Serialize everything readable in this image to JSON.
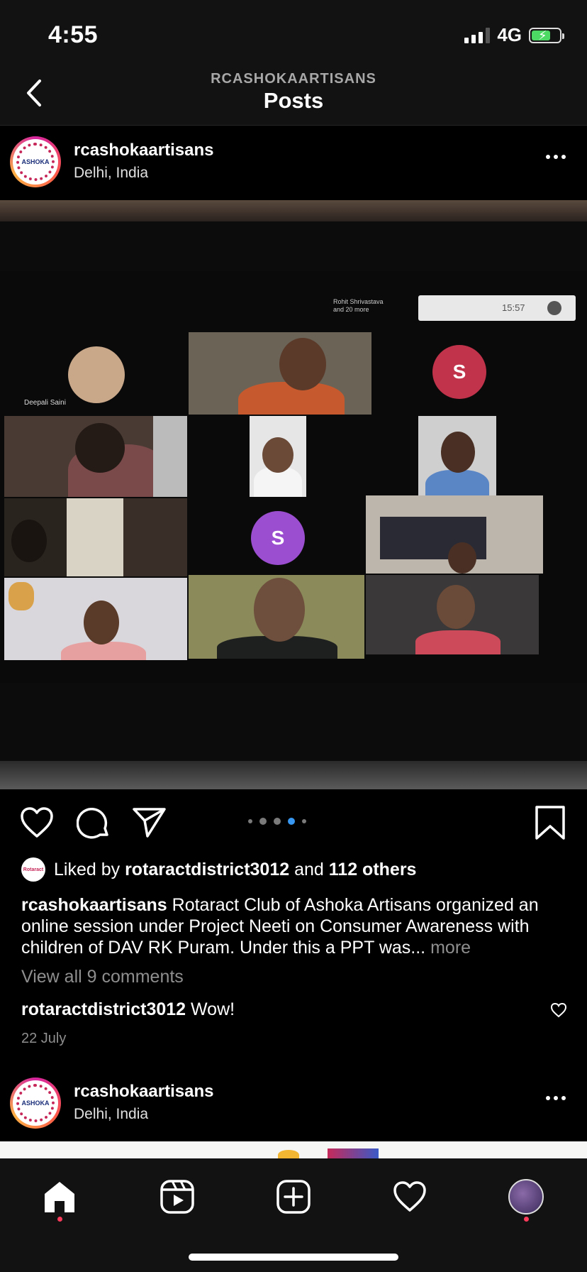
{
  "status_bar": {
    "time": "4:55",
    "network": "4G",
    "battery_percent": 60,
    "signal_bars_on": 3,
    "signal_bars_total": 4
  },
  "header": {
    "subtitle": "RCASHOKAARTISANS",
    "title": "Posts"
  },
  "post": {
    "username": "rcashokaartisans",
    "location": "Delhi, India",
    "carousel": {
      "count": 5,
      "active_index": 3
    },
    "photo_screen": {
      "participant_caption": "Deepali Saini",
      "participants_label_line1": "Rohit Shrivastava",
      "participants_label_line2": "and 20 more",
      "clock": "15:57",
      "initial_1": "S",
      "initial_2": "S"
    },
    "likes": {
      "prefix": "Liked by",
      "user": "rotaractdistrict3012",
      "joiner": "and",
      "others": "112 others",
      "avatar_text": "Rotaract"
    },
    "caption": {
      "user": "rcashokaartisans",
      "text": "Rotaract Club of Ashoka Artisans organized an online session under Project Neeti on Consumer Awareness with children of DAV RK Puram.  Under this a PPT was...",
      "more": "more"
    },
    "view_comments": "View all 9 comments",
    "top_comment": {
      "user": "rotaractdistrict3012",
      "text": "Wow!"
    },
    "date": "22 July",
    "avatar_logo_text": "ASHOKA"
  },
  "next_post": {
    "username": "rcashokaartisans",
    "location": "Delhi, India",
    "avatar_logo_text": "ASHOKA"
  },
  "tabs": [
    "home",
    "reels",
    "new-post",
    "activity",
    "profile"
  ],
  "colors": {
    "background": "#000000",
    "bar": "#121212",
    "accent_dot": "#ff3b5c",
    "active_carousel_dot": "#3897f0",
    "battery_green": "#4cd964"
  }
}
